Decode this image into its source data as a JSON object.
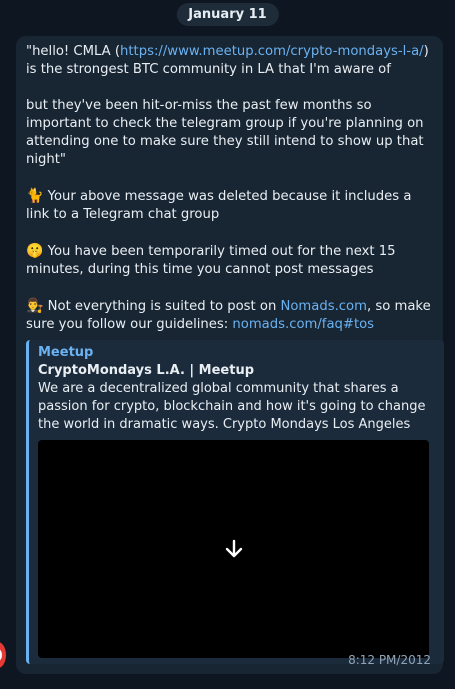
{
  "date_chip": "January 11",
  "message": {
    "quote_open": "\"hello! CMLA (",
    "quote_link": "https://www.meetup.com/crypto-mondays-l-a/",
    "quote_after_link": ") is the strongest BTC community in LA that I'm aware of",
    "quote_para2": "but they've been hit-or-miss the past few months so important to check the telegram group if you're planning on attending one to make sure they still intend to show up that night\"",
    "deleted_emoji": "🐈",
    "deleted_text": "Your above message was deleted because it includes a link to a Telegram chat group",
    "timeout_emoji": "🤫",
    "timeout_text": "You have been temporarily timed out for the next 15 minutes, during this time you cannot post messages",
    "guidelines_emoji": "👨‍⚖️",
    "guidelines_pre": "Not everything is suited to post on ",
    "guidelines_link1": "Nomads.com",
    "guidelines_mid": ", so make sure you follow our guidelines: ",
    "guidelines_link2": "nomads.com/faq#tos"
  },
  "preview": {
    "site_name": "Meetup",
    "title": "CryptoMondays L.A. | Meetup",
    "description": "We are a decentralized global community that shares a passion for crypto, blockchain and how it's going to change the world in dramatic ways. Crypto Mondays Los Angeles offers a place to ne…",
    "media_icon": "download-arrow-icon"
  },
  "timestamp": "8:12 PM/2012",
  "colors": {
    "background": "#0e1621",
    "bubble": "#182533",
    "link": "#6ab2f2",
    "accent_bar": "#6ab2f2"
  }
}
